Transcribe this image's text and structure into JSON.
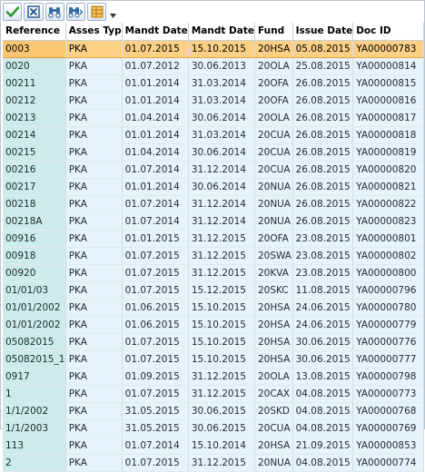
{
  "toolbar": {
    "buttons": [
      {
        "icon": "checkmark-icon"
      },
      {
        "icon": "cancel-icon"
      },
      {
        "icon": "binoculars-find-icon"
      },
      {
        "icon": "binoculars-find-next-icon"
      },
      {
        "icon": "layout-icon"
      }
    ],
    "menu_icon": "dropdown-arrow-icon"
  },
  "columns": [
    "Reference",
    "Asses Typ",
    "Mandt Date",
    "Mandt Date",
    "Fund",
    "Issue Date",
    "Doc ID"
  ],
  "rows": [
    [
      "0003",
      "PKA",
      "01.07.2015",
      "15.10.2015",
      "20HSA",
      "05.08.2015",
      "YA00000783"
    ],
    [
      "0020",
      "PKA",
      "01.07.2012",
      "30.06.2013",
      "20OLA",
      "25.08.2015",
      "YA00000814"
    ],
    [
      "00211",
      "PKA",
      "01.01.2014",
      "31.03.2014",
      "20OFA",
      "26.08.2015",
      "YA00000815"
    ],
    [
      "00212",
      "PKA",
      "01.01.2014",
      "31.03.2014",
      "20OFA",
      "26.08.2015",
      "YA00000816"
    ],
    [
      "00213",
      "PKA",
      "01.04.2014",
      "30.06.2014",
      "20OLA",
      "26.08.2015",
      "YA00000817"
    ],
    [
      "00214",
      "PKA",
      "01.01.2014",
      "31.03.2014",
      "20CUA",
      "26.08.2015",
      "YA00000818"
    ],
    [
      "00215",
      "PKA",
      "01.04.2014",
      "30.06.2014",
      "20CUA",
      "26.08.2015",
      "YA00000819"
    ],
    [
      "00216",
      "PKA",
      "01.07.2014",
      "31.12.2014",
      "20CUA",
      "26.08.2015",
      "YA00000820"
    ],
    [
      "00217",
      "PKA",
      "01.01.2014",
      "30.06.2014",
      "20NUA",
      "26.08.2015",
      "YA00000821"
    ],
    [
      "00218",
      "PKA",
      "01.07.2014",
      "31.12.2014",
      "20NUA",
      "26.08.2015",
      "YA00000822"
    ],
    [
      "00218A",
      "PKA",
      "01.07.2014",
      "31.12.2014",
      "20NUA",
      "26.08.2015",
      "YA00000823"
    ],
    [
      "00916",
      "PKA",
      "01.01.2015",
      "31.12.2015",
      "20OFA",
      "23.08.2015",
      "YA00000801"
    ],
    [
      "00918",
      "PKA",
      "01.07.2015",
      "31.12.2015",
      "20SWA",
      "23.08.2015",
      "YA00000802"
    ],
    [
      "00920",
      "PKA",
      "01.07.2015",
      "31.12.2015",
      "20KVA",
      "23.08.2015",
      "YA00000800"
    ],
    [
      "01/01/03",
      "PKA",
      "01.07.2015",
      "15.12.2015",
      "20SKC",
      "11.08.2015",
      "YA00000796"
    ],
    [
      "01/01/2002",
      "PKA",
      "01.06.2015",
      "15.10.2015",
      "20HSA",
      "24.06.2015",
      "YA00000780"
    ],
    [
      "01/01/2002",
      "PKA",
      "01.06.2015",
      "15.10.2015",
      "20HSA",
      "24.06.2015",
      "YA00000779"
    ],
    [
      "05082015",
      "PKA",
      "01.07.2015",
      "15.10.2015",
      "20HSA",
      "30.06.2015",
      "YA00000776"
    ],
    [
      "05082015_1",
      "PKA",
      "01.07.2015",
      "15.10.2015",
      "20HSA",
      "30.06.2015",
      "YA00000777"
    ],
    [
      "0917",
      "PKA",
      "01.09.2015",
      "31.12.2015",
      "20OLA",
      "13.08.2015",
      "YA00000798"
    ],
    [
      "1",
      "PKA",
      "01.07.2015",
      "31.12.2015",
      "20CAX",
      "04.08.2015",
      "YA00000773"
    ],
    [
      "1/1/2002",
      "PKA",
      "31.05.2015",
      "30.06.2015",
      "20SKD",
      "04.08.2015",
      "YA00000768"
    ],
    [
      "1/1/2003",
      "PKA",
      "31.05.2015",
      "30.06.2015",
      "20CUA",
      "04.08.2015",
      "YA00000769"
    ],
    [
      "113",
      "PKA",
      "01.07.2014",
      "15.10.2014",
      "20HSA",
      "21.09.2015",
      "YA00000853"
    ],
    [
      "2",
      "PKA",
      "01.07.2015",
      "31.12.2015",
      "20NUA",
      "04.08.2015",
      "YA00000774"
    ]
  ],
  "selected_row": 0,
  "colors": {
    "key_column_bg": "#ccebe9",
    "row_bg": "#e6f3fb",
    "selected_row_bg": "#fcd085"
  }
}
